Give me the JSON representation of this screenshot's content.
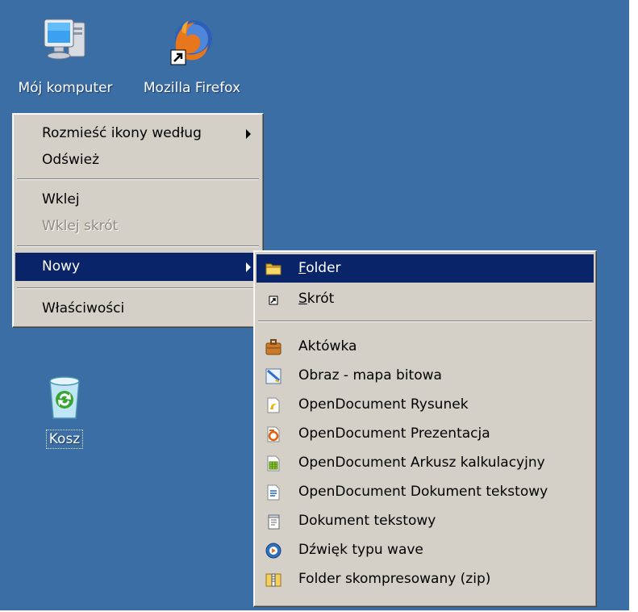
{
  "desktop": {
    "background": "#3b6ea5",
    "icons": [
      {
        "label": "Mój komputer",
        "icon": "my-computer-icon"
      },
      {
        "label": "Mozilla Firefox",
        "icon": "firefox-icon"
      },
      {
        "label": "Kosz",
        "icon": "recycle-bin-icon"
      }
    ]
  },
  "context_menu": {
    "items": [
      {
        "label": "Rozmieść ikony według",
        "submenu": true
      },
      {
        "label": "Odśwież"
      },
      {
        "label": "Wklej"
      },
      {
        "label": "Wklej skrót",
        "disabled": true
      },
      {
        "label": "Nowy",
        "submenu": true,
        "highlighted": true
      },
      {
        "label": "Właściwości"
      }
    ]
  },
  "new_submenu": {
    "folder": {
      "accel": "F",
      "rest": "older",
      "icon": "folder-icon",
      "highlighted": true
    },
    "shortcut": {
      "accel": "S",
      "rest": "krót",
      "icon": "shortcut-icon"
    },
    "items": [
      {
        "label": "Aktówka",
        "icon": "briefcase-icon"
      },
      {
        "label": "Obraz - mapa bitowa",
        "icon": "bitmap-icon"
      },
      {
        "label": "OpenDocument Rysunek",
        "icon": "od-drawing-icon"
      },
      {
        "label": "OpenDocument Prezentacja",
        "icon": "od-presentation-icon"
      },
      {
        "label": "OpenDocument Arkusz kalkulacyjny",
        "icon": "od-spreadsheet-icon"
      },
      {
        "label": "OpenDocument Dokument tekstowy",
        "icon": "od-text-document-icon"
      },
      {
        "label": "Dokument tekstowy",
        "icon": "text-document-icon"
      },
      {
        "label": "Dźwięk typu wave",
        "icon": "wave-sound-icon"
      },
      {
        "label": "Folder skompresowany (zip)",
        "icon": "zip-folder-icon"
      }
    ]
  },
  "colors": {
    "menu_bg": "#d4d0c8",
    "highlight": "#0a246a",
    "disabled_text": "#8f8c85"
  }
}
